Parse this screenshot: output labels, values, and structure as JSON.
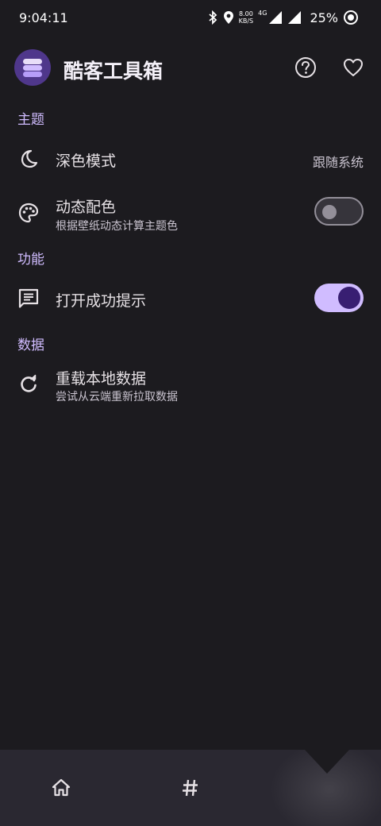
{
  "status": {
    "time": "9:04:11",
    "net_speed_value": "8.00",
    "net_speed_unit": "KB/S",
    "net_type": "4G",
    "battery": "25%",
    "icons": [
      "bluetooth-icon",
      "location-icon",
      "signal-icon",
      "battery-icon"
    ]
  },
  "app": {
    "title": "酷客工具箱",
    "actions": [
      "help-icon",
      "heart-icon"
    ]
  },
  "sections": {
    "theme": "主题",
    "function": "功能",
    "data": "数据"
  },
  "settings": {
    "dark_mode": {
      "title": "深色模式",
      "value": "跟随系统",
      "icon": "moon-icon"
    },
    "dynamic_color": {
      "title": "动态配色",
      "subtitle": "根据壁纸动态计算主题色",
      "enabled": false,
      "icon": "palette-icon"
    },
    "open_success_tip": {
      "title": "打开成功提示",
      "enabled": true,
      "icon": "message-icon"
    },
    "reload_data": {
      "title": "重载本地数据",
      "subtitle": "尝试从云端重新拉取数据",
      "icon": "refresh-icon"
    }
  },
  "bottom_nav": {
    "items": [
      "home-icon",
      "hash-icon"
    ]
  },
  "colors": {
    "background": "#1c1b1f",
    "accent": "#d0bcff",
    "switch_on_knob": "#381e72",
    "nav_background": "#2a2831"
  }
}
